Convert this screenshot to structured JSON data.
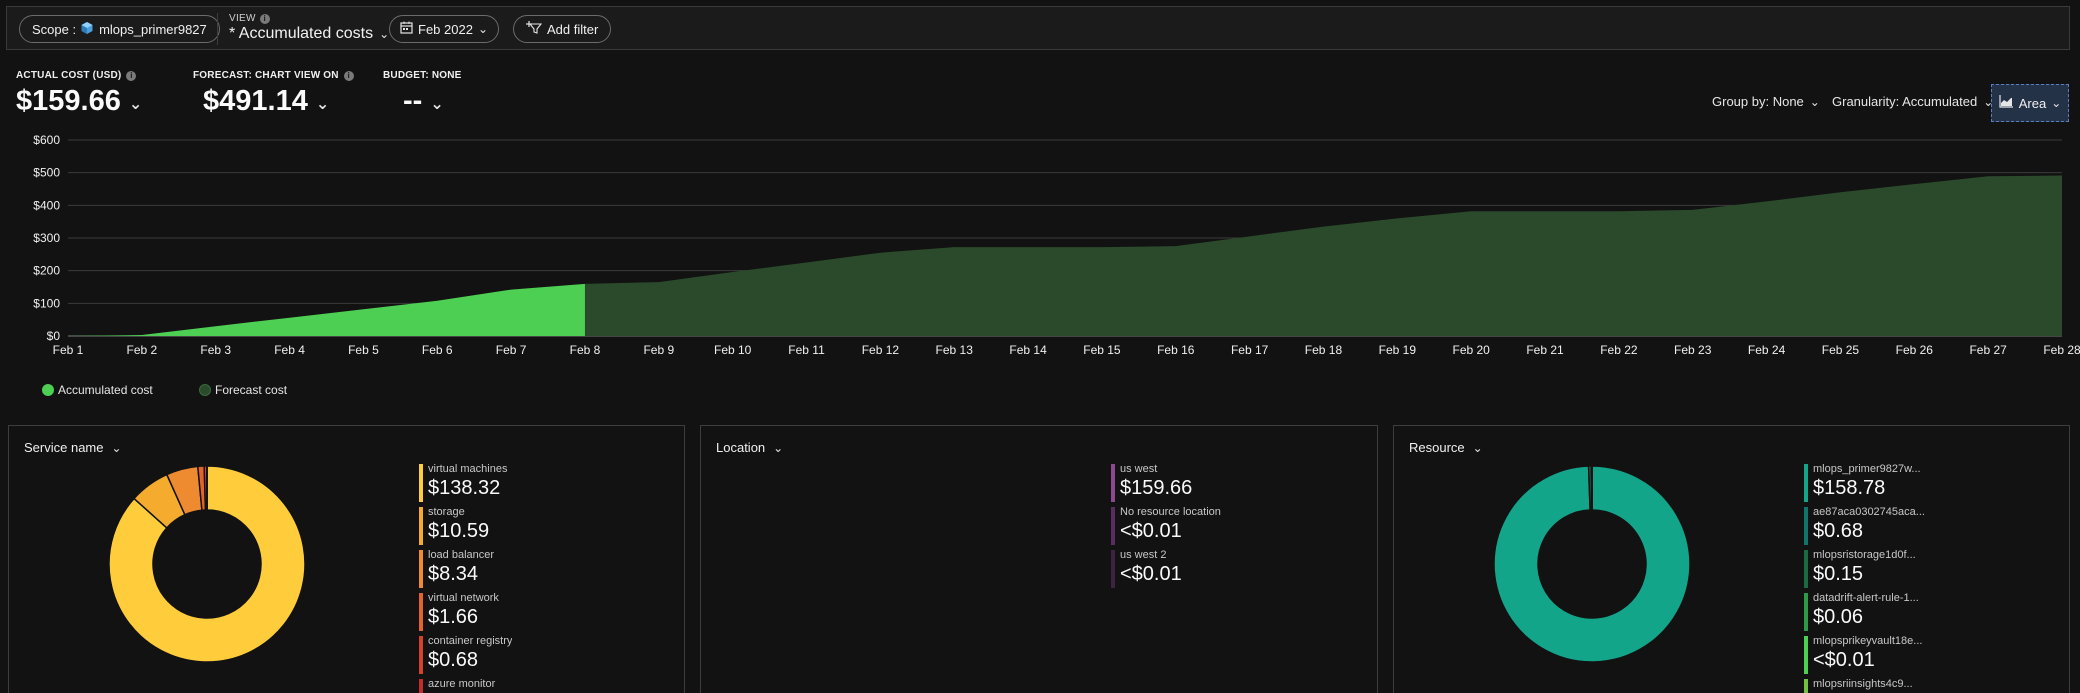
{
  "toolbar": {
    "scope_label": "Scope :",
    "scope_value": "mlops_primer9827",
    "view_caption": "VIEW",
    "view_value": "* Accumulated costs",
    "date_value": "Feb 2022",
    "add_filter_label": "Add filter"
  },
  "kpis": {
    "actual": {
      "caption": "ACTUAL COST (USD)",
      "value": "$159.66"
    },
    "forecast": {
      "caption": "FORECAST: CHART VIEW ON",
      "value": "$491.14"
    },
    "budget": {
      "caption": "BUDGET: NONE",
      "value": "--"
    }
  },
  "controls": {
    "group_by": "Group by: None",
    "granularity": "Granularity: Accumulated",
    "chart_type": "Area"
  },
  "legend": {
    "accumulated": "Accumulated cost",
    "forecast": "Forecast cost"
  },
  "colors": {
    "accumulated": "#4ccf52",
    "forecast": "#2b4a2c",
    "panel_border": "#3d3d3d"
  },
  "chart_data": {
    "type": "area",
    "x": [
      "Feb 1",
      "Feb 2",
      "Feb 3",
      "Feb 4",
      "Feb 5",
      "Feb 6",
      "Feb 7",
      "Feb 8",
      "Feb 9",
      "Feb 10",
      "Feb 11",
      "Feb 12",
      "Feb 13",
      "Feb 14",
      "Feb 15",
      "Feb 16",
      "Feb 17",
      "Feb 18",
      "Feb 19",
      "Feb 20",
      "Feb 21",
      "Feb 22",
      "Feb 23",
      "Feb 24",
      "Feb 25",
      "Feb 26",
      "Feb 27",
      "Feb 28"
    ],
    "y_ticks": [
      "$0",
      "$100",
      "$200",
      "$300",
      "$400",
      "$500",
      "$600"
    ],
    "ylim": [
      0,
      600
    ],
    "grid": true,
    "series": [
      {
        "name": "Accumulated cost",
        "values": [
          0,
          3,
          30,
          56,
          82,
          108,
          142,
          159.66,
          null,
          null,
          null,
          null,
          null,
          null,
          null,
          null,
          null,
          null,
          null,
          null,
          null,
          null,
          null,
          null,
          null,
          null,
          null,
          null
        ]
      },
      {
        "name": "Forecast cost",
        "values": [
          null,
          null,
          null,
          null,
          null,
          null,
          null,
          159.66,
          165,
          196,
          225,
          255,
          272,
          272,
          272,
          275,
          305,
          335,
          360,
          382,
          382,
          382,
          386,
          412,
          440,
          465,
          489,
          491.14
        ]
      }
    ]
  },
  "panels": [
    {
      "title": "Service name",
      "items": [
        {
          "name": "virtual machines",
          "value": "$138.32",
          "amount": 138.32,
          "color": "#ffcd3c"
        },
        {
          "name": "storage",
          "value": "$10.59",
          "amount": 10.59,
          "color": "#f5ac2e"
        },
        {
          "name": "load balancer",
          "value": "$8.34",
          "amount": 8.34,
          "color": "#ee8a30"
        },
        {
          "name": "virtual network",
          "value": "$1.66",
          "amount": 1.66,
          "color": "#e0642b"
        },
        {
          "name": "container registry",
          "value": "$0.68",
          "amount": 0.68,
          "color": "#d64226"
        },
        {
          "name": "azure monitor",
          "value": "",
          "amount": 0.05,
          "color": "#c42b2b"
        }
      ]
    },
    {
      "title": "Location",
      "items": [
        {
          "name": "us west",
          "value": "$159.66",
          "amount": 159.66,
          "color": "#8e4791"
        },
        {
          "name": "No resource location",
          "value": "<$0.01",
          "amount": 0.0,
          "color": "#5c2b60"
        },
        {
          "name": "us west 2",
          "value": "<$0.01",
          "amount": 0.0,
          "color": "#3e2242"
        }
      ]
    },
    {
      "title": "Resource",
      "items": [
        {
          "name": "mlops_primer9827w...",
          "value": "$158.78",
          "amount": 158.78,
          "color": "#13a58a"
        },
        {
          "name": "ae87aca0302745aca...",
          "value": "$0.68",
          "amount": 0.68,
          "color": "#10756a"
        },
        {
          "name": "mlopsristorage1d0f...",
          "value": "$0.15",
          "amount": 0.15,
          "color": "#1b6b42"
        },
        {
          "name": "datadrift-alert-rule-1...",
          "value": "$0.06",
          "amount": 0.06,
          "color": "#2e9a48"
        },
        {
          "name": "mlopsprikeyvault18e...",
          "value": "<$0.01",
          "amount": 0.0,
          "color": "#4ccf52"
        },
        {
          "name": "mlopsriinsights4c9...",
          "value": "",
          "amount": 0.0,
          "color": "#72c23f"
        }
      ]
    }
  ]
}
